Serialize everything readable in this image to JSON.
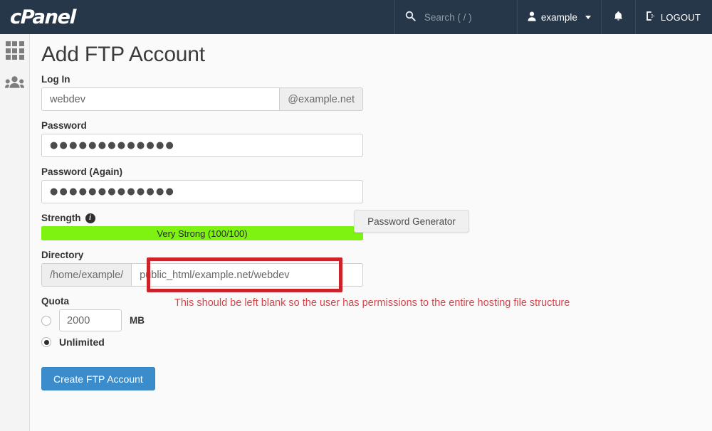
{
  "header": {
    "brand": "cPanel",
    "search": {
      "icon": "search-icon",
      "placeholder": "Search ( / )",
      "value": ""
    },
    "user": {
      "icon": "user-icon",
      "name": "example",
      "caret": "chevron-down-icon"
    },
    "bell": {
      "icon": "bell-icon"
    },
    "logout": {
      "icon": "logout-icon",
      "label": "LOGOUT"
    },
    "bg_color": "#27374a"
  },
  "sidebar": {
    "items": [
      {
        "name": "apps-grid",
        "icon": "grid-icon"
      },
      {
        "name": "user-manager",
        "icon": "users-icon"
      }
    ]
  },
  "main": {
    "title": "Add FTP Account",
    "login": {
      "label": "Log In",
      "value": "webdev",
      "domain_addon": "@example.net"
    },
    "password": {
      "label": "Password",
      "masked": "●●●●●●●●●●●●●"
    },
    "password_again": {
      "label": "Password (Again)",
      "masked": "●●●●●●●●●●●●●"
    },
    "strength": {
      "label": "Strength",
      "info_icon": "info-icon",
      "text": "Very Strong (100/100)",
      "percent": 100,
      "bar_color": "#7ef211"
    },
    "password_generator": {
      "label": "Password Generator"
    },
    "directory": {
      "label": "Directory",
      "prefix": "/home/example/",
      "value": "public_html/example.net/webdev",
      "highlight_color": "#cc2229"
    },
    "annotation": {
      "text": "This should be left blank so the user has permissions to the entire hosting file structure",
      "color": "#d7454b"
    },
    "quota": {
      "label": "Quota",
      "limited_selected": false,
      "value": "2000",
      "unit": "MB",
      "unlimited_label": "Unlimited",
      "unlimited_selected": true
    },
    "submit": {
      "label": "Create FTP Account",
      "color": "#3a8ccb"
    }
  }
}
